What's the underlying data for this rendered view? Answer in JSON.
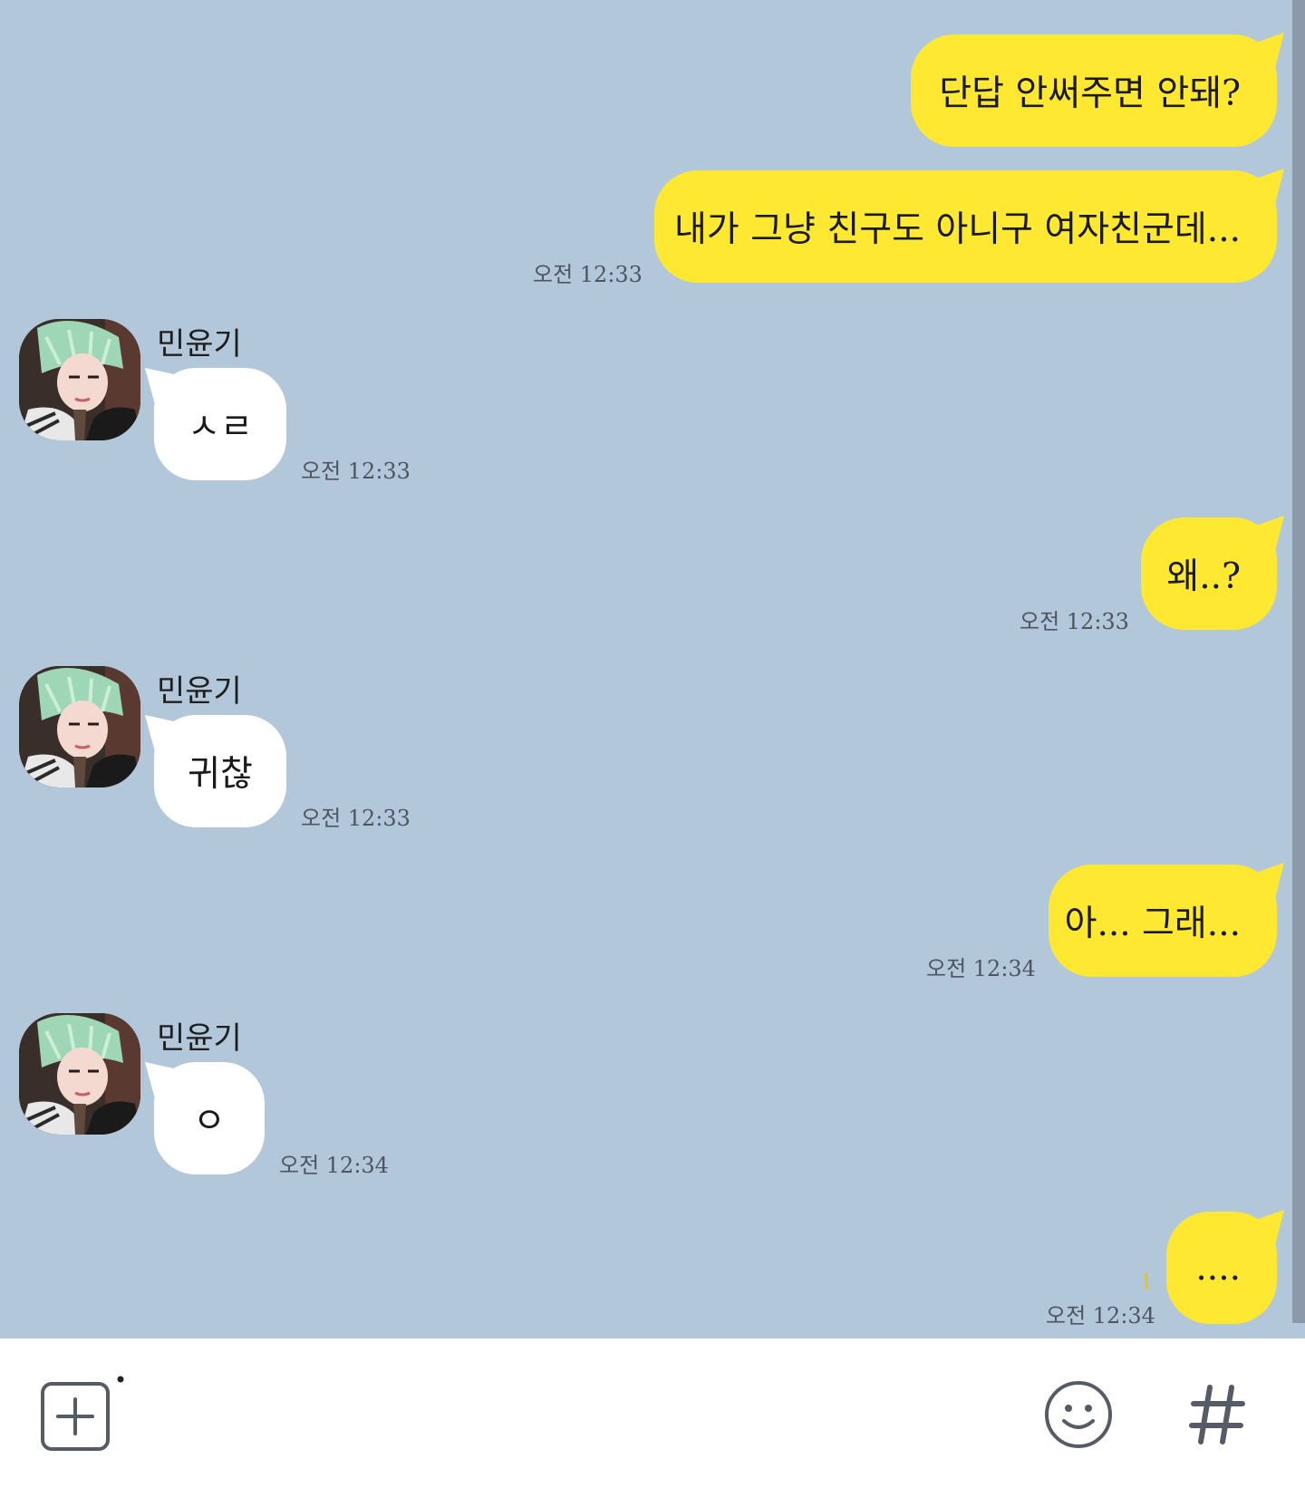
{
  "contact": {
    "name": "민윤기"
  },
  "messages": [
    {
      "from": "me",
      "text": "단답 안써주면 안돼?",
      "time": ""
    },
    {
      "from": "me",
      "text": "내가 그냥 친구도 아니구 여자친군데...",
      "time": "오전 12:33"
    },
    {
      "from": "them",
      "sender": "민윤기",
      "text": "ㅅㄹ",
      "time": "오전 12:33"
    },
    {
      "from": "me",
      "text": "왜..?",
      "time": "오전 12:33"
    },
    {
      "from": "them",
      "sender": "민윤기",
      "text": "귀찮",
      "time": "오전 12:33"
    },
    {
      "from": "me",
      "text": "아... 그래...",
      "time": "오전 12:34"
    },
    {
      "from": "them",
      "sender": "민윤기",
      "text": "ㅇ",
      "time": "오전 12:34"
    },
    {
      "from": "me",
      "text": "....",
      "time": "오전 12:34",
      "unread": "1"
    }
  ],
  "input_bar": {
    "icons": [
      "plus-square-icon",
      "emoji-icon",
      "hash-icon"
    ]
  },
  "colors": {
    "background": "#b2c7da",
    "my_bubble": "#fee832",
    "their_bubble": "#ffffff",
    "unread": "#e3c51f"
  }
}
